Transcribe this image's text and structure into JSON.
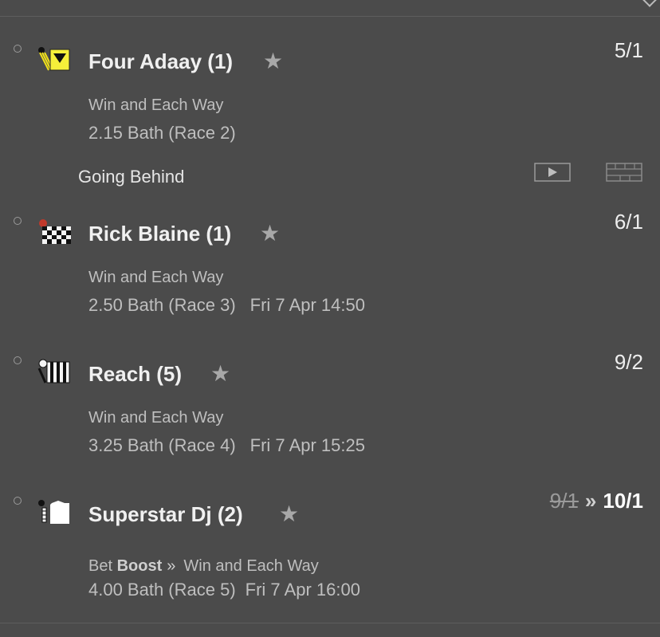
{
  "selections": [
    {
      "name": "Four Adaay (1)",
      "odds": "5/1",
      "market": "Win and Each Way",
      "event": "2.15 Bath (Race 2)",
      "datetime": "",
      "status": "Going Behind",
      "silk": "yellow-down-triangle-silk"
    },
    {
      "name": "Rick Blaine (1)",
      "odds": "6/1",
      "market": "Win and Each Way",
      "event": "2.50 Bath (Race 3)",
      "datetime": "Fri 7 Apr 14:50",
      "silk": "checkered-silk"
    },
    {
      "name": "Reach (5)",
      "odds": "9/2",
      "market": "Win and Each Way",
      "event": "3.25 Bath (Race 4)",
      "datetime": "Fri 7 Apr 15:25",
      "silk": "black-white-stripes-silk"
    },
    {
      "name": "Superstar Dj (2)",
      "odds_old": "9/1",
      "odds": "10/1",
      "market_prefix": "Bet",
      "boost_label": "Boost",
      "market": "Win and Each Way",
      "event": "4.00 Bath (Race 5)",
      "datetime": "Fri 7 Apr 16:00",
      "silk": "white-silk"
    }
  ],
  "icons": {
    "favourite": "star-icon",
    "watch": "play-icon",
    "racecard": "racecard-icon",
    "boost_arrow": "double-chevron-icon"
  },
  "colors": {
    "background": "#4b4b4b",
    "text": "#e6e6e6",
    "muted": "#bfbfbf"
  }
}
